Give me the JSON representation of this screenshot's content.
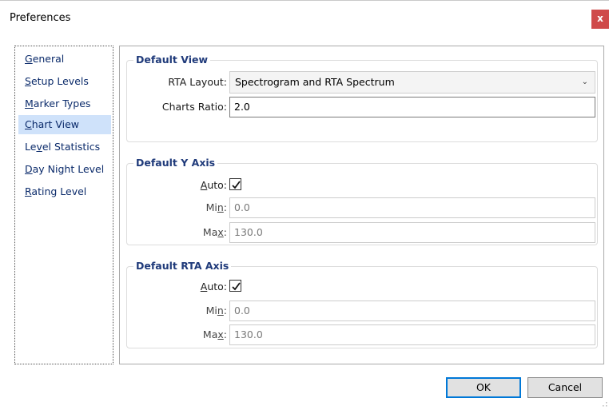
{
  "window": {
    "title": "Preferences",
    "close_label": "x"
  },
  "nav": {
    "items": [
      {
        "label": "General",
        "mnemonic_index": 0,
        "selected": false
      },
      {
        "label": "Setup Levels",
        "mnemonic_index": 0,
        "selected": false
      },
      {
        "label": "Marker Types",
        "mnemonic_index": 0,
        "selected": false
      },
      {
        "label": "Chart View",
        "mnemonic_index": 0,
        "selected": true
      },
      {
        "label": "Level Statistics",
        "mnemonic_index": 2,
        "selected": false
      },
      {
        "label": "Day Night Level",
        "mnemonic_index": 0,
        "selected": false
      },
      {
        "label": "Rating Level",
        "mnemonic_index": 0,
        "selected": false
      }
    ]
  },
  "default_view": {
    "title": "Default View",
    "rta_layout_label": "RTA Layout:",
    "rta_layout_value": "Spectrogram and RTA Spectrum",
    "charts_ratio_label": "Charts Ratio:",
    "charts_ratio_value": "2.0"
  },
  "default_y_axis": {
    "title": "Default Y Axis",
    "auto_label": "Auto:",
    "auto_checked": true,
    "min_label": "Min:",
    "min_value": "0.0",
    "max_label": "Max:",
    "max_value": "130.0"
  },
  "default_rta_axis": {
    "title": "Default RTA Axis",
    "auto_label": "Auto:",
    "auto_checked": true,
    "min_label": "Min:",
    "min_value": "0.0",
    "max_label": "Max:",
    "max_value": "130.0"
  },
  "buttons": {
    "ok_label": "OK",
    "cancel_label": "Cancel"
  },
  "colors": {
    "accent": "#0078d7",
    "close_bg": "#cf4a4a",
    "selection": "#cfe2fa",
    "group_title": "#1f3a7a"
  }
}
